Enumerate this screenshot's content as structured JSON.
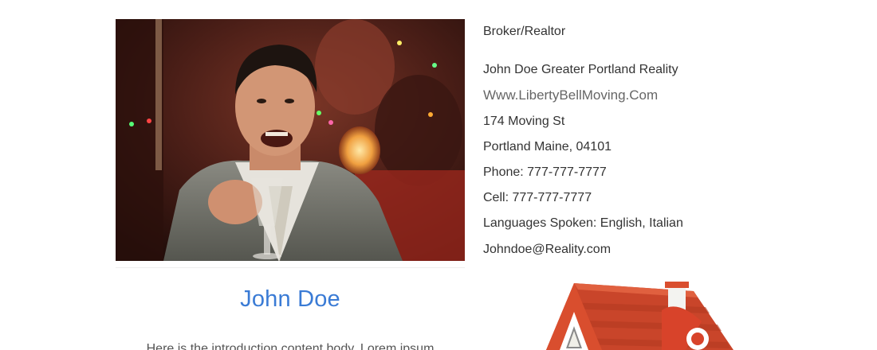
{
  "profile": {
    "name": "John Doe",
    "intro": "Here is the introduction content body. Lorem ipsum"
  },
  "contact": {
    "title": "Broker/Realtor",
    "company": "John Doe Greater Portland Reality",
    "website": "Www.LibertyBellMoving.Com",
    "address_line1": "174 Moving St",
    "address_line2": "Portland Maine, 04101",
    "phone": "Phone: 777-777-7777",
    "cell": "Cell: 777-777-7777",
    "languages": "Languages Spoken: English, Italian",
    "email": "Johndoe@Reality.com"
  },
  "colors": {
    "name_accent": "#3a7bd5",
    "roof": "#c9452a"
  },
  "icons": {
    "house": "house-icon"
  }
}
